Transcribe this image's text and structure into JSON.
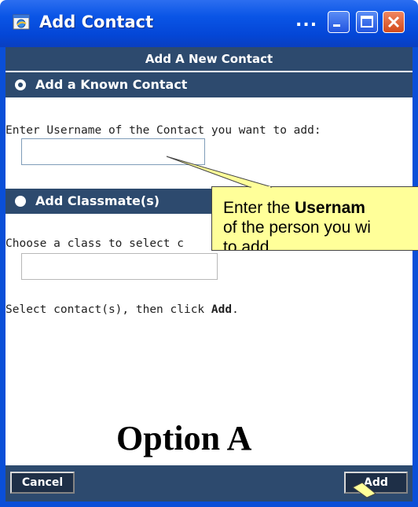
{
  "window": {
    "title": "Add Contact",
    "title_dots": "...",
    "icons": [
      "app-icon",
      "minimize-icon",
      "maximize-icon",
      "close-icon"
    ]
  },
  "dialog": {
    "header": "Add A New Contact",
    "known_contact": {
      "label": "Add a Known Contact",
      "prompt": "Enter Username of the Contact you want to add:",
      "input_value": ""
    },
    "classmates": {
      "label": "Add Classmate(s)",
      "prompt": "Choose a class to select c",
      "select_value": ""
    },
    "instruction_prefix": "Select contact(s), then click ",
    "instruction_bold": "Add",
    "instruction_suffix": ".",
    "buttons": {
      "cancel": "Cancel",
      "add": "Add"
    }
  },
  "callout": {
    "line1_prefix": "Enter the ",
    "line1_bold": "Usernam",
    "line2": "of the person you wi",
    "line3": "to add."
  },
  "annotation": {
    "option_label": "Option A"
  },
  "colors": {
    "titlebar": "#0a55e6",
    "panel": "#2d4a6e",
    "callout": "#ffff99"
  }
}
